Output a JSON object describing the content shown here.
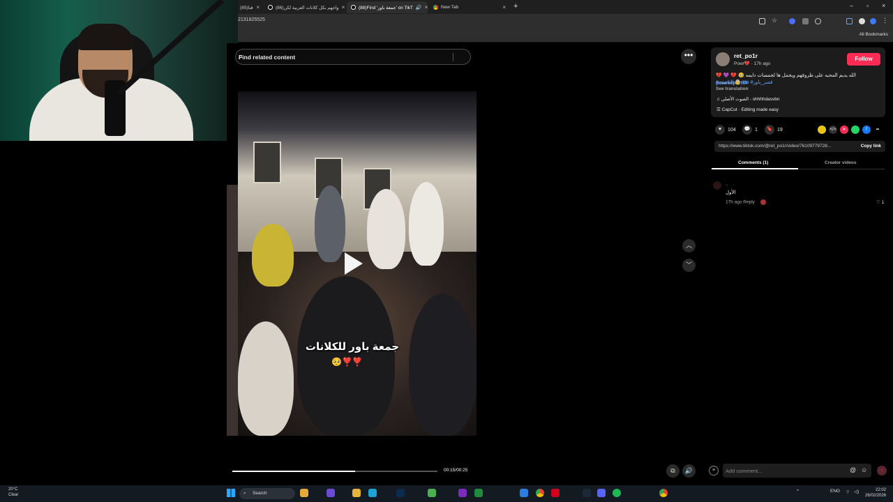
{
  "browser": {
    "tabs": [
      {
        "label": "(85)قنا"
      },
      {
        "label": "(86)واجهم بكل كلانات العربية لكن"
      },
      {
        "label": "(88)Find 'جمعة باور' on TikT"
      },
      {
        "label": "New Tab"
      }
    ],
    "new_tab_symbol": "+",
    "url": "2131825525",
    "bookmarks_label": "All Bookmarks"
  },
  "search": {
    "placeholder": "Find related content"
  },
  "video": {
    "caption": "جمعة باور للكلانات",
    "emoji": "🥺❣️❣️",
    "progress": 0.6,
    "timecode": "00:15/00:25"
  },
  "post": {
    "username": "ret_po1r",
    "meta": "Powr💔 · 17h ago",
    "follow_label": "Follow",
    "description": "الله يديم المحبه على ظروفهم ويجمل ها لجمسات دايمه 🥹 💔 💜 💔",
    "description_tag": "#powresports",
    "tags": "#الثانيبث 👵 #tu #قصر_باور",
    "see_translation": "See translation",
    "sound": "♫ الصوت الأصلي - shhhhdasvbn",
    "capcut": "CapCut · Editing made easy",
    "likes": "104",
    "comments": "1",
    "saves": "19",
    "link": "https://www.tiktok.com/@ret_po1r/video/761097797​28...",
    "copy_link": "Copy link",
    "tab_comments": "Comments (1)",
    "tab_creator": "Creator videos"
  },
  "comment": {
    "name": "..",
    "text": "الأول",
    "meta": "17h ago   Reply",
    "likes": "1"
  },
  "comment_input": {
    "placeholder": "Add comment..."
  },
  "taskbar": {
    "weather_temp": "20°C",
    "weather_cond": "Clear",
    "search_label": "Search",
    "lang": "ENG",
    "time": "22:02",
    "date": "26/02/2026"
  },
  "colors": {
    "follow": "#fe2c55",
    "tag": "#6aa6ff",
    "background": "#000000"
  }
}
